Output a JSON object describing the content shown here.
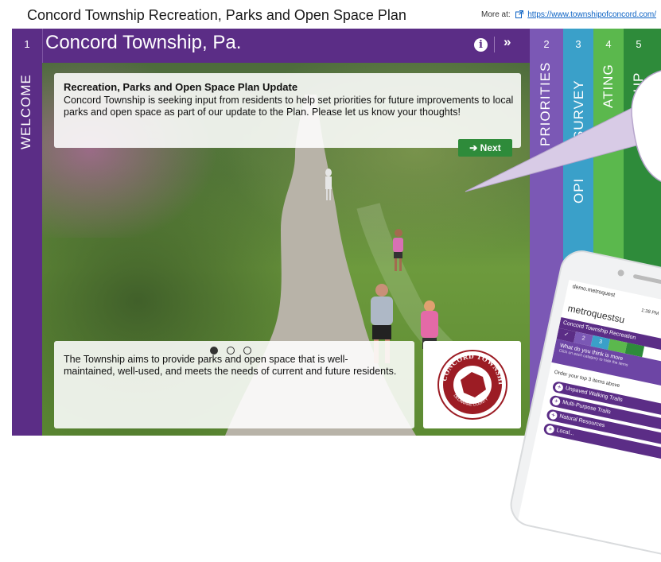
{
  "app": {
    "title": "Concord Township Recreation, Parks and Open Space Plan",
    "more_label": "More at:",
    "more_link": "https://www.townshipofconcord.com/"
  },
  "header": {
    "step_number": "1",
    "step_label": "WELCOME",
    "title": "Concord Township, Pa.",
    "info_icon": "i",
    "collapse_icon": "»"
  },
  "intro_card": {
    "heading": "Recreation, Parks and Open Space Plan Update",
    "body": "Concord Township is seeking input from residents to help set priorities for future improvements to local parks and open space as part of our update to the Plan. Please let us know your thoughts!",
    "next_label": "➔ Next"
  },
  "carousel": {
    "slide_count": 3,
    "active_index": 0
  },
  "bottom_card": {
    "body": "The Township aims to provide parks and open space that is well-maintained, well-used, and meets the needs of current and future residents."
  },
  "logo": {
    "text_top": "CONCORD TOWNSHIP",
    "text_bottom": "DELAWARE COUNTY"
  },
  "tabs": [
    {
      "number": "2",
      "label": "PRIORITIES",
      "color": "#7b58b5"
    },
    {
      "number": "3",
      "label": "SURVEY",
      "label2": "OPI",
      "color": "#3aa0c9"
    },
    {
      "number": "4",
      "label": "ATING",
      "color": "#5bb84d"
    },
    {
      "number": "5",
      "label": "P UP",
      "color": "#2e8b3a"
    }
  ],
  "phone": {
    "url": "demo.metroquest",
    "time": "1:38 PM",
    "url2": "metroquestsu",
    "title": "Concord Township Recreation",
    "steps": [
      "✓",
      "2",
      "3"
    ],
    "question": "What do you think is more",
    "question_sub": "Click on each category to hide the items",
    "instruction": "Order your top 3 items above",
    "items": [
      "Unpaved Walking Trails",
      "Multi-Purpose Trails",
      "Natural Resources",
      "Local..."
    ]
  },
  "colors": {
    "brand_purple": "#5b2d86",
    "next_green": "#2e8b3a",
    "link_blue": "#0b62c4"
  }
}
